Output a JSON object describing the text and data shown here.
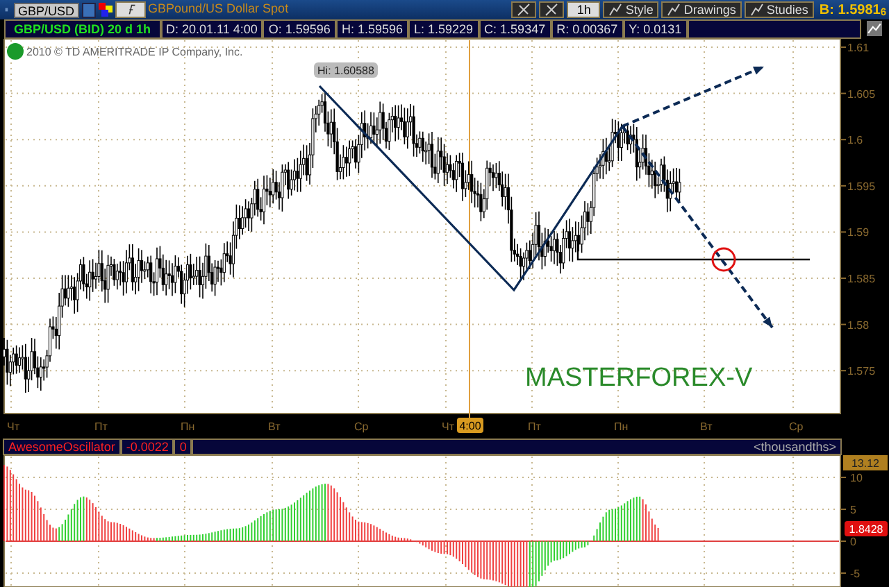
{
  "toolbar": {
    "symbol": "GBP/USD",
    "description": "GBPound/US Dollar Spot",
    "interval": "1h",
    "buttons": [
      "Style",
      "Drawings",
      "Studies"
    ],
    "bid": "B: 1.5981$_{6}$"
  },
  "info_bar": {
    "title": "GBP/USD (BID) 20 d 1h",
    "fields": [
      "D: 20.01.11 4:00",
      "O: 1.59596",
      "H: 1.59596",
      "L: 1.59229",
      "C: 1.59347",
      "R: 0.00367",
      "Y: 0.0131"
    ]
  },
  "chart": {
    "copyright": "2010 © TD AMERITRADE IP Company, Inc.",
    "high_label": "Hi: 1.60588",
    "annotation": "MASTERFOREX-V",
    "price_axis": [
      "1.61",
      "1.605",
      "1.6",
      "1.595",
      "1.59",
      "1.585",
      "1.58",
      "1.575"
    ],
    "time_axis": [
      "Чт",
      "Пт",
      "Пн",
      "Вт",
      "Ср",
      "Чт",
      "Пт",
      "Пн",
      "Вт",
      "Ср"
    ],
    "cursor_time": "4:00"
  },
  "oscillator": {
    "name": "AwesomeOscillator",
    "value": "-0.0022",
    "setting": "0",
    "units": "<thousandths>",
    "max_label": "13.12",
    "current_label": "1.8428",
    "axis": [
      "10",
      "5",
      "0",
      "-5"
    ]
  }
}
